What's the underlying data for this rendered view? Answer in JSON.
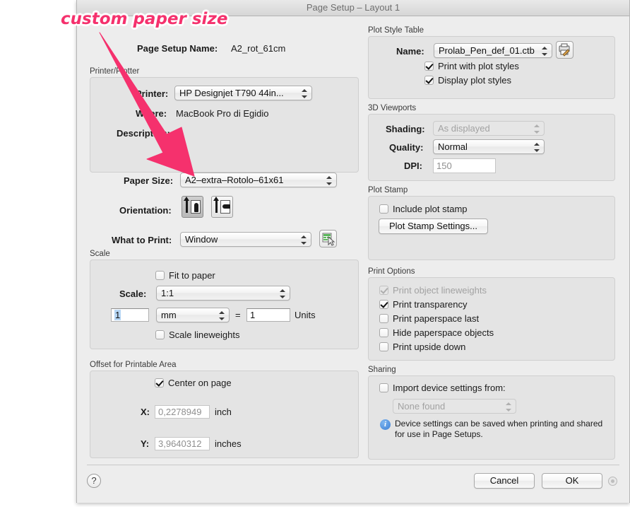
{
  "window": {
    "title": "Page Setup – Layout 1"
  },
  "annotation": {
    "text": "custom paper size",
    "color": "#f5316d",
    "outline_color": "#ffffff",
    "arrow": "down-right-arrow pointing at Paper Size popup"
  },
  "page_setup_name": {
    "label": "Page Setup Name:",
    "value": "A2_rot_61cm"
  },
  "printer_plotter": {
    "group_title": "Printer/Plotter",
    "printer_label": "Printer:",
    "printer_value": "HP Designjet T790 44in...",
    "where_label": "Where:",
    "where_value": "MacBook Pro di Egidio",
    "description_label": "Description:",
    "description_value": ""
  },
  "paper": {
    "paper_size_label": "Paper Size:",
    "paper_size_value": "A2–extra–Rotolo–61x61",
    "orientation_label": "Orientation:",
    "orientation_portrait_icon": "portrait-orientation-icon",
    "orientation_landscape_icon": "landscape-orientation-icon",
    "orientation_selected": "portrait",
    "what_to_print_label": "What to Print:",
    "what_to_print_value": "Window",
    "window_pick_icon": "window-pick-icon"
  },
  "scale": {
    "group_title": "Scale",
    "fit_to_paper_label": "Fit to paper",
    "fit_to_paper_checked": false,
    "scale_label": "Scale:",
    "scale_value": "1:1",
    "numerator_value": "1",
    "unit_value": "mm",
    "equals": "=",
    "denominator_value": "1",
    "units_label": "Units",
    "scale_lineweights_label": "Scale lineweights",
    "scale_lineweights_checked": false
  },
  "offset": {
    "group_title": "Offset for Printable Area",
    "center_on_page_label": "Center on page",
    "center_on_page_checked": true,
    "x_label": "X:",
    "x_value": "0,2278949",
    "x_unit": "inch",
    "y_label": "Y:",
    "y_value": "3,9640312",
    "y_unit": "inches"
  },
  "plot_style_table": {
    "group_title": "Plot Style Table",
    "name_label": "Name:",
    "name_value": "Prolab_Pen_def_01.ctb",
    "edit_icon": "plot-style-edit-icon",
    "print_with_plot_styles_label": "Print with plot styles",
    "print_with_plot_styles_checked": true,
    "display_plot_styles_label": "Display plot styles",
    "display_plot_styles_checked": true
  },
  "viewports_3d": {
    "group_title": "3D Viewports",
    "shading_label": "Shading:",
    "shading_value": "As displayed",
    "shading_disabled": true,
    "quality_label": "Quality:",
    "quality_value": "Normal",
    "dpi_label": "DPI:",
    "dpi_value": "150"
  },
  "plot_stamp": {
    "group_title": "Plot Stamp",
    "include_label": "Include plot stamp",
    "include_checked": false,
    "settings_button": "Plot Stamp Settings..."
  },
  "print_options": {
    "group_title": "Print Options",
    "items": [
      {
        "label": "Print object lineweights",
        "checked": true,
        "disabled": true
      },
      {
        "label": "Print transparency",
        "checked": true,
        "disabled": false
      },
      {
        "label": "Print paperspace last",
        "checked": false,
        "disabled": false
      },
      {
        "label": "Hide paperspace objects",
        "checked": false,
        "disabled": false
      },
      {
        "label": "Print upside down",
        "checked": false,
        "disabled": false
      }
    ]
  },
  "sharing": {
    "group_title": "Sharing",
    "import_label": "Import device settings from:",
    "import_checked": false,
    "source_value": "None found",
    "source_disabled": true,
    "info_icon": "info-icon",
    "info_line1": "Device settings can be saved when printing and shared",
    "info_line2": "for use in Page Setups."
  },
  "footer": {
    "help_label": "?",
    "cancel_label": "Cancel",
    "ok_label": "OK",
    "resize_grip": "resize-grip-icon"
  }
}
